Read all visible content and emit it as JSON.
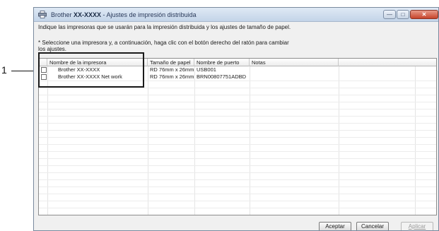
{
  "callout": {
    "label": "1"
  },
  "window": {
    "title_brand": "Brother",
    "title_model": "XX-XXXX",
    "title_rest": " - Ajustes de impresión distribuida",
    "min_glyph": "—",
    "max_glyph": "□",
    "close_glyph": "✕"
  },
  "description": "Indique las impresoras que se usarán para la impresión distribuida y los ajustes de tamaño de papel.",
  "note_line1": "* Seleccione una impresora y, a continuación, haga clic con el botón derecho del ratón para cambiar",
  "note_line2": "los ajustes.",
  "table": {
    "columns": [
      "Nombre de la impresora",
      "Tamaño de papel",
      "Nombre de puerto",
      "Notas"
    ],
    "rows": [
      {
        "checked": false,
        "printer": "Brother XX-XXXX",
        "paper": "RD 76mm x 26mm",
        "port": "USB001",
        "notes": ""
      },
      {
        "checked": false,
        "printer": "Brother XX-XXXX Net work",
        "paper": "RD 76mm x 26mm",
        "port": "BRN00807751ADBD",
        "notes": ""
      }
    ]
  },
  "buttons": {
    "ok": "Aceptar",
    "cancel": "Cancelar",
    "apply": "Aplicar"
  },
  "colors": {
    "titlebar": "#c3d4e8",
    "close_button": "#c6442c",
    "disabled_text": "#9a9a9a"
  }
}
